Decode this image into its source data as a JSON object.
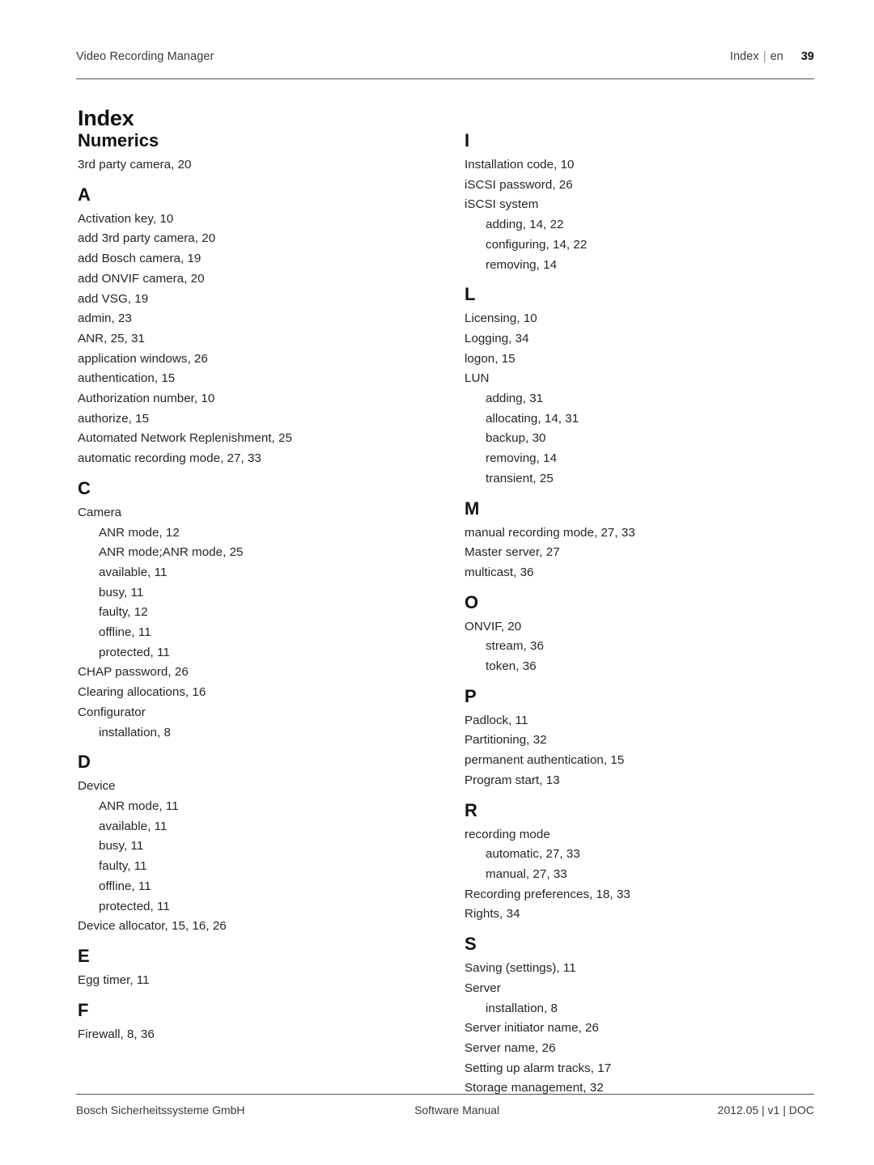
{
  "header": {
    "product": "Video Recording Manager",
    "doc_section": "Index",
    "separator": "|",
    "language": "en",
    "page_number": "39"
  },
  "title": "Index",
  "columns": {
    "left": [
      {
        "heading": "Numerics",
        "heading_type": "word",
        "entries": [
          {
            "text": "3rd party camera, 20",
            "level": 0
          }
        ]
      },
      {
        "heading": "A",
        "heading_type": "letter",
        "entries": [
          {
            "text": "Activation key, 10",
            "level": 0
          },
          {
            "text": "add 3rd party camera, 20",
            "level": 0
          },
          {
            "text": "add Bosch camera, 19",
            "level": 0
          },
          {
            "text": "add ONVIF camera, 20",
            "level": 0
          },
          {
            "text": "add VSG, 19",
            "level": 0
          },
          {
            "text": "admin, 23",
            "level": 0
          },
          {
            "text": "ANR, 25, 31",
            "level": 0
          },
          {
            "text": "application windows, 26",
            "level": 0
          },
          {
            "text": "authentication, 15",
            "level": 0
          },
          {
            "text": "Authorization number, 10",
            "level": 0
          },
          {
            "text": "authorize, 15",
            "level": 0
          },
          {
            "text": "Automated Network Replenishment, 25",
            "level": 0
          },
          {
            "text": "automatic recording mode, 27, 33",
            "level": 0
          }
        ]
      },
      {
        "heading": "C",
        "heading_type": "letter",
        "entries": [
          {
            "text": "Camera",
            "level": 0
          },
          {
            "text": "ANR mode, 12",
            "level": 1
          },
          {
            "text": "ANR mode;ANR mode, 25",
            "level": 1
          },
          {
            "text": "available, 11",
            "level": 1
          },
          {
            "text": "busy, 11",
            "level": 1
          },
          {
            "text": "faulty, 12",
            "level": 1
          },
          {
            "text": "offline, 11",
            "level": 1
          },
          {
            "text": "protected, 11",
            "level": 1
          },
          {
            "text": "CHAP password, 26",
            "level": 0
          },
          {
            "text": "Clearing allocations, 16",
            "level": 0
          },
          {
            "text": "Configurator",
            "level": 0
          },
          {
            "text": "installation, 8",
            "level": 1
          }
        ]
      },
      {
        "heading": "D",
        "heading_type": "letter",
        "entries": [
          {
            "text": "Device",
            "level": 0
          },
          {
            "text": "ANR mode, 11",
            "level": 1
          },
          {
            "text": "available, 11",
            "level": 1
          },
          {
            "text": "busy, 11",
            "level": 1
          },
          {
            "text": "faulty, 11",
            "level": 1
          },
          {
            "text": "offline, 11",
            "level": 1
          },
          {
            "text": "protected, 11",
            "level": 1
          },
          {
            "text": "Device allocator, 15, 16, 26",
            "level": 0
          }
        ]
      },
      {
        "heading": "E",
        "heading_type": "letter",
        "entries": [
          {
            "text": "Egg timer, 11",
            "level": 0
          }
        ]
      },
      {
        "heading": "F",
        "heading_type": "letter",
        "entries": [
          {
            "text": "Firewall, 8, 36",
            "level": 0
          }
        ]
      }
    ],
    "right": [
      {
        "heading": "I",
        "heading_type": "letter",
        "entries": [
          {
            "text": "Installation code, 10",
            "level": 0
          },
          {
            "text": "iSCSI password, 26",
            "level": 0
          },
          {
            "text": "iSCSI system",
            "level": 0
          },
          {
            "text": "adding, 14, 22",
            "level": 1
          },
          {
            "text": "configuring, 14, 22",
            "level": 1
          },
          {
            "text": "removing, 14",
            "level": 1
          }
        ]
      },
      {
        "heading": "L",
        "heading_type": "letter",
        "entries": [
          {
            "text": "Licensing, 10",
            "level": 0
          },
          {
            "text": "Logging, 34",
            "level": 0
          },
          {
            "text": "logon, 15",
            "level": 0
          },
          {
            "text": "LUN",
            "level": 0
          },
          {
            "text": "adding, 31",
            "level": 1
          },
          {
            "text": "allocating, 14, 31",
            "level": 1
          },
          {
            "text": "backup, 30",
            "level": 1
          },
          {
            "text": "removing, 14",
            "level": 1
          },
          {
            "text": "transient, 25",
            "level": 1
          }
        ]
      },
      {
        "heading": "M",
        "heading_type": "letter",
        "entries": [
          {
            "text": "manual recording mode, 27, 33",
            "level": 0
          },
          {
            "text": "Master server, 27",
            "level": 0
          },
          {
            "text": "multicast, 36",
            "level": 0
          }
        ]
      },
      {
        "heading": "O",
        "heading_type": "letter",
        "entries": [
          {
            "text": "ONVIF, 20",
            "level": 0
          },
          {
            "text": "stream, 36",
            "level": 1
          },
          {
            "text": "token, 36",
            "level": 1
          }
        ]
      },
      {
        "heading": "P",
        "heading_type": "letter",
        "entries": [
          {
            "text": "Padlock, 11",
            "level": 0
          },
          {
            "text": "Partitioning, 32",
            "level": 0
          },
          {
            "text": "permanent authentication, 15",
            "level": 0
          },
          {
            "text": "Program start, 13",
            "level": 0
          }
        ]
      },
      {
        "heading": "R",
        "heading_type": "letter",
        "entries": [
          {
            "text": "recording mode",
            "level": 0
          },
          {
            "text": "automatic, 27, 33",
            "level": 1
          },
          {
            "text": "manual, 27, 33",
            "level": 1
          },
          {
            "text": "Recording preferences, 18, 33",
            "level": 0
          },
          {
            "text": "Rights, 34",
            "level": 0
          }
        ]
      },
      {
        "heading": "S",
        "heading_type": "letter",
        "entries": [
          {
            "text": "Saving (settings), 11",
            "level": 0
          },
          {
            "text": "Server",
            "level": 0
          },
          {
            "text": "installation, 8",
            "level": 1
          },
          {
            "text": "Server initiator name, 26",
            "level": 0
          },
          {
            "text": "Server name, 26",
            "level": 0
          },
          {
            "text": "Setting up alarm tracks, 17",
            "level": 0
          },
          {
            "text": "Storage management, 32",
            "level": 0
          }
        ]
      }
    ]
  },
  "footer": {
    "company": "Bosch Sicherheitssysteme GmbH",
    "doc_type": "Software Manual",
    "version": "2012.05 | v1 | DOC"
  }
}
